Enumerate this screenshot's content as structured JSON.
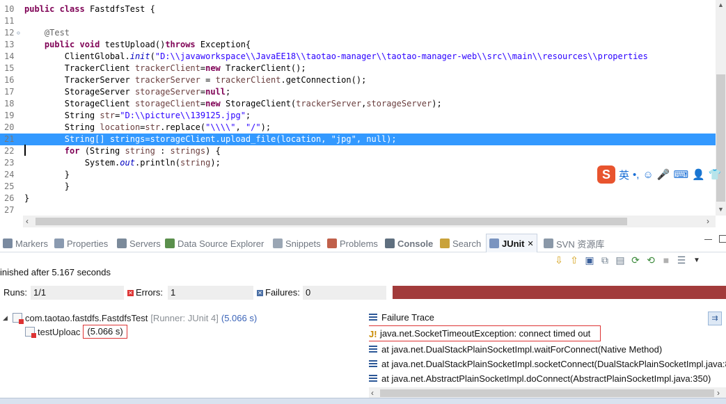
{
  "editor": {
    "lines": [
      {
        "num": "10",
        "tokens": [
          [
            "kw",
            "public "
          ],
          [
            "kw",
            "class "
          ],
          [
            "",
            "FastdfsTest {"
          ]
        ]
      },
      {
        "num": "11",
        "tokens": []
      },
      {
        "num": "12",
        "fold": true,
        "tokens": [
          [
            "",
            "    "
          ],
          [
            "ann",
            "@Test"
          ]
        ]
      },
      {
        "num": "13",
        "tokens": [
          [
            "",
            "    "
          ],
          [
            "kw",
            "public "
          ],
          [
            "kw",
            "void "
          ],
          [
            "",
            "testUpload()"
          ],
          [
            "kw",
            "throws "
          ],
          [
            "",
            "Exception{"
          ]
        ]
      },
      {
        "num": "14",
        "tokens": [
          [
            "",
            "        ClientGlobal."
          ],
          [
            "fld",
            "init"
          ],
          [
            "",
            "("
          ],
          [
            "str",
            "\"D:\\\\javaworkspace\\\\JavaEE18\\\\taotao-manager\\\\taotao-manager-web\\\\src\\\\main\\\\resources\\\\properties"
          ]
        ]
      },
      {
        "num": "15",
        "tokens": [
          [
            "",
            "        TrackerClient "
          ],
          [
            "var",
            "trackerClient"
          ],
          [
            "",
            "="
          ],
          [
            "kw",
            "new "
          ],
          [
            "",
            "TrackerClient();"
          ]
        ]
      },
      {
        "num": "16",
        "tokens": [
          [
            "",
            "        TrackerServer "
          ],
          [
            "var",
            "trackerServer"
          ],
          [
            "",
            " = "
          ],
          [
            "var",
            "trackerClient"
          ],
          [
            "",
            ".getConnection();"
          ]
        ]
      },
      {
        "num": "17",
        "tokens": [
          [
            "",
            "        StorageServer "
          ],
          [
            "var",
            "storageServer"
          ],
          [
            "",
            "="
          ],
          [
            "kw",
            "null"
          ],
          [
            "",
            ";"
          ]
        ]
      },
      {
        "num": "18",
        "tokens": [
          [
            "",
            "        StorageClient "
          ],
          [
            "var",
            "storageClient"
          ],
          [
            "",
            "="
          ],
          [
            "kw",
            "new "
          ],
          [
            "",
            "StorageClient("
          ],
          [
            "var",
            "trackerServer"
          ],
          [
            "",
            ","
          ],
          [
            "var",
            "storageServer"
          ],
          [
            "",
            ");"
          ]
        ]
      },
      {
        "num": "19",
        "tokens": [
          [
            "",
            "        String "
          ],
          [
            "var",
            "str"
          ],
          [
            "",
            "="
          ],
          [
            "str",
            "\"D:\\\\picture\\\\139125.jpg\""
          ],
          [
            "",
            ";"
          ]
        ]
      },
      {
        "num": "20",
        "tokens": [
          [
            "",
            "        String "
          ],
          [
            "var",
            "location"
          ],
          [
            "",
            "="
          ],
          [
            "var",
            "str"
          ],
          [
            "",
            ".replace("
          ],
          [
            "str",
            "\"\\\\\\\\\""
          ],
          [
            "",
            ", "
          ],
          [
            "str",
            "\"/\""
          ],
          [
            "",
            ");"
          ]
        ]
      },
      {
        "num": "21",
        "selected": true,
        "tokens": [
          [
            "",
            "        String[] strings=storageClient.upload_file(location, \"jpg\", null);"
          ]
        ]
      },
      {
        "num": "22",
        "tokens": [
          [
            "",
            "        "
          ],
          [
            "kw",
            "for "
          ],
          [
            "",
            "(String "
          ],
          [
            "var",
            "string"
          ],
          [
            "",
            " : "
          ],
          [
            "var",
            "strings"
          ],
          [
            "",
            ") {"
          ]
        ]
      },
      {
        "num": "23",
        "tokens": [
          [
            "",
            "            System."
          ],
          [
            "fld",
            "out"
          ],
          [
            "",
            ".println("
          ],
          [
            "var",
            "string"
          ],
          [
            "",
            ");"
          ]
        ]
      },
      {
        "num": "24",
        "tokens": [
          [
            "",
            "        }"
          ]
        ]
      },
      {
        "num": "25",
        "tokens": [
          [
            "",
            "        }"
          ]
        ]
      },
      {
        "num": "26",
        "tokens": [
          [
            "",
            "}"
          ]
        ]
      },
      {
        "num": "27",
        "tokens": []
      }
    ]
  },
  "ime": {
    "logo": "S",
    "items": [
      "英",
      "•,",
      "☺",
      "🎤",
      "⌨",
      "👤",
      "👕"
    ]
  },
  "tabs": [
    {
      "label": "Markers",
      "color": "#7a8aa0"
    },
    {
      "label": "Properties",
      "color": "#8a9ab0"
    },
    {
      "label": "Servers",
      "color": "#7b8a9a"
    },
    {
      "label": "Data Source Explorer",
      "color": "#5a8f4c"
    },
    {
      "label": "Snippets",
      "color": "#9aa6b4"
    },
    {
      "label": "Problems",
      "color": "#c0604a"
    },
    {
      "label": "Console",
      "color": "#5f6f7f"
    },
    {
      "label": "Search",
      "color": "#c9a23a"
    },
    {
      "label": "JUnit",
      "color": "#7a94c0",
      "active": true,
      "close": "✕"
    },
    {
      "label": "SVN 资源库",
      "color": "#8a98a8"
    }
  ],
  "junit": {
    "status": "inished after 5.167 seconds",
    "runs_label": "Runs:",
    "runs_value": "1/1",
    "errors_label": "Errors:",
    "errors_value": "1",
    "failures_label": "Failures:",
    "failures_value": "0",
    "progress_color": "#a23b3b",
    "tree": {
      "suite_name": "com.taotao.fastdfs.FastdfsTest",
      "suite_runner": "[Runner: JUnit 4]",
      "suite_time": "(5.066 s)",
      "test_name": "testUploac",
      "test_time": "(5.066 s)"
    },
    "trace": {
      "header": "Failure Trace",
      "exception": "java.net.SocketTimeoutException: connect timed out",
      "frames": [
        "at java.net.DualStackPlainSocketImpl.waitForConnect(Native Method)",
        "at java.net.DualStackPlainSocketImpl.socketConnect(DualStackPlainSocketImpl.java:8",
        "at java.net.AbstractPlainSocketImpl.doConnect(AbstractPlainSocketImpl.java:350)"
      ]
    }
  }
}
